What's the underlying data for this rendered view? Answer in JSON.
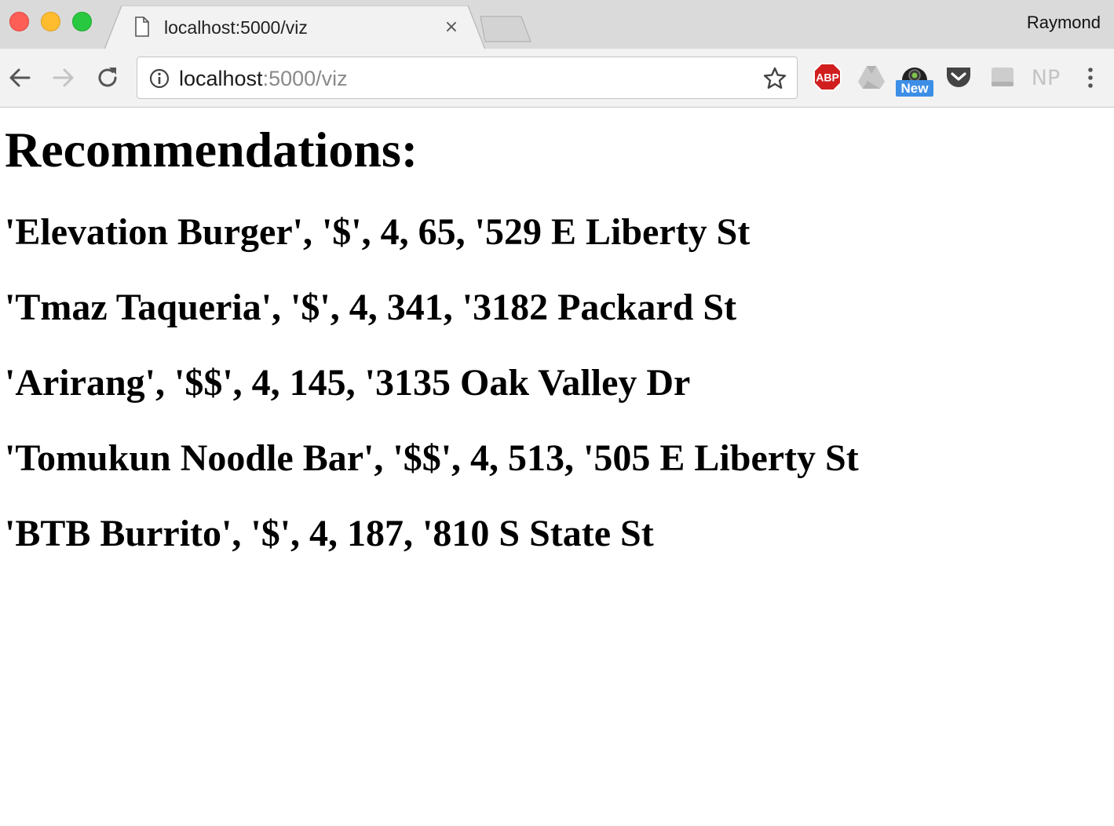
{
  "browser": {
    "tab": {
      "title": "localhost:5000/viz",
      "close_glyph": "×"
    },
    "profile_name": "Raymond",
    "address": {
      "host": "localhost",
      "rest": ":5000/viz"
    },
    "extensions": {
      "abp_label": "ABP",
      "new_badge": "New",
      "np_label": "NP"
    }
  },
  "page": {
    "heading": "Recommendations:",
    "recommendations": [
      "'Elevation Burger', '$', 4, 65, '529 E Liberty St",
      "'Tmaz Taqueria', '$', 4, 341, '3182 Packard St",
      "'Arirang', '$$', 4, 145, '3135 Oak Valley Dr",
      "'Tomukun Noodle Bar', '$$', 4, 513, '505 E Liberty St",
      "'BTB Burrito', '$', 4, 187, '810 S State St"
    ]
  },
  "colors": {
    "close_red": "#fd5f57",
    "minimize_yellow": "#febc2e",
    "zoom_green": "#28c840",
    "abp_red": "#d11f1f",
    "new_badge_blue": "#3d8ee6"
  }
}
